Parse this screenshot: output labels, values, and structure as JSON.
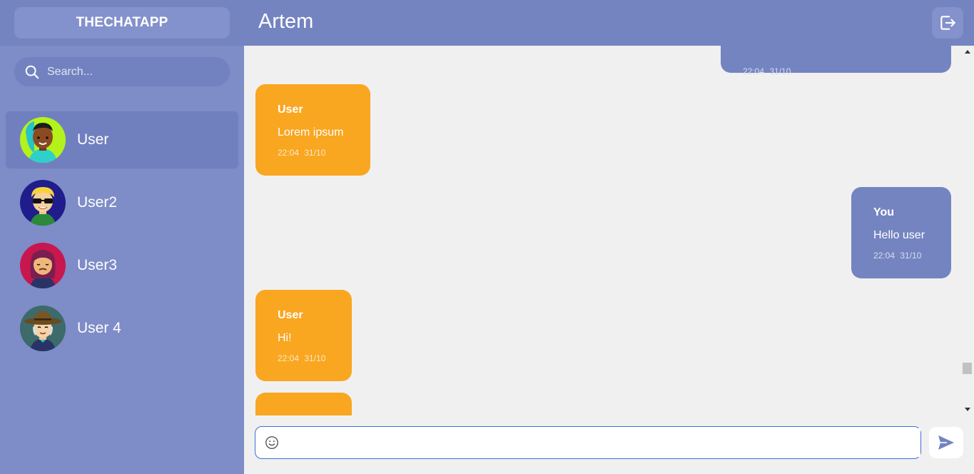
{
  "app": {
    "brand": "THECHATAPP"
  },
  "search": {
    "placeholder": "Search..."
  },
  "contacts": [
    {
      "name": "User",
      "active": true
    },
    {
      "name": "User2",
      "active": false
    },
    {
      "name": "User3",
      "active": false
    },
    {
      "name": "User 4",
      "active": false
    }
  ],
  "chat": {
    "title": "Artem"
  },
  "messages": [
    {
      "author": "",
      "text": "",
      "time": "22:04  31/10",
      "direction": "out"
    },
    {
      "author": "User",
      "text": "Lorem ipsum",
      "time": "22:04  31/10",
      "direction": "in"
    },
    {
      "author": "You",
      "text": "Hello user",
      "time": "22:04  31/10",
      "direction": "out"
    },
    {
      "author": "User",
      "text": "Hi!",
      "time": "22:04  31/10",
      "direction": "in"
    },
    {
      "author": "",
      "text": "",
      "time": "",
      "direction": "in"
    }
  ],
  "composer": {
    "value": "",
    "placeholder": ""
  },
  "icons": {
    "logout": "logout-icon",
    "search": "search-icon",
    "emoji": "emoji-icon",
    "send": "send-icon"
  },
  "colors": {
    "sidebar": "#7e8cc7",
    "header": "#7484c1",
    "incoming": "#f9a620",
    "outgoing": "#7484c1",
    "background": "#f0f0f0"
  }
}
